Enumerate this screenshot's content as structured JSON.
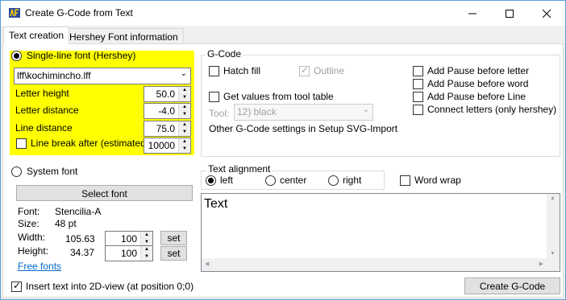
{
  "window": {
    "title": "Create G-Code from Text"
  },
  "tabs": [
    "Text creation",
    "Hershey Font information"
  ],
  "hershey": {
    "radio_label": "Single-line font (Hershey)",
    "font_file": "lff\\kochimincho.lff",
    "letter_height_label": "Letter height",
    "letter_height": "50.0",
    "letter_distance_label": "Letter distance",
    "letter_distance": "-4.0",
    "line_distance_label": "Line distance",
    "line_distance": "75.0",
    "line_break_label": "Line break after (estimated)",
    "line_break": "10000"
  },
  "gcode": {
    "group_title": "G-Code",
    "hatch_fill": "Hatch fill",
    "outline": "Outline",
    "get_values": "Get values from tool table",
    "tool_label": "Tool:",
    "tool_value": "12) black",
    "other_settings": "Other G-Code settings in Setup SVG-Import",
    "pause_letter": "Add Pause before letter",
    "pause_word": "Add Pause before word",
    "pause_line": "Add Pause before Line",
    "connect_letters": "Connect letters (only hershey)"
  },
  "system_font": {
    "radio_label": "System font",
    "select_button": "Select font",
    "font_label": "Font:",
    "font_value": "Stencilia-A",
    "size_label": "Size:",
    "size_value": "48 pt",
    "width_label": "Width:",
    "width_value": "105.63",
    "width_pct": "100",
    "height_label": "Height:",
    "height_value": "34.37",
    "height_pct": "100",
    "set_label": "set",
    "free_fonts": "Free fonts"
  },
  "alignment": {
    "group_title": "Text alignment",
    "left": "left",
    "center": "center",
    "right": "right",
    "word_wrap": "Word wrap"
  },
  "text_input": {
    "value": "Text"
  },
  "insert_text_label": "Insert text into 2D-view (at position 0;0)",
  "create_button": "Create G-Code",
  "colors": {
    "highlight": "#ffff00",
    "window_border": "#5a9fd8",
    "link": "#0066cc"
  }
}
